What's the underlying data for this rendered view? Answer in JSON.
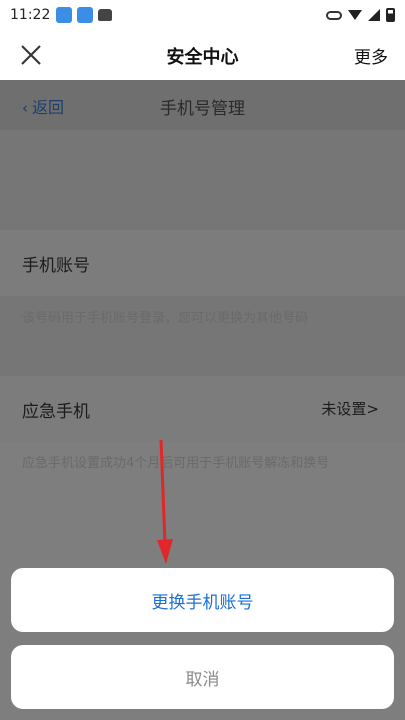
{
  "status_bar": {
    "time": "11:22"
  },
  "title_bar": {
    "title": "安全中心",
    "more_label": "更多"
  },
  "sub_header": {
    "back_label": "返回",
    "back_chevron": "‹",
    "title": "手机号管理"
  },
  "phone_account": {
    "label": "手机账号",
    "description": "该号码用于手机账号登录，您可以更换为其他号码"
  },
  "emergency_phone": {
    "label": "应急手机",
    "value": "未设置>",
    "description": "应急手机设置成功4个月后可用于手机账号解冻和换号"
  },
  "action_sheet": {
    "primary_label": "更换手机账号",
    "cancel_label": "取消"
  },
  "colors": {
    "accent": "#1b6fd6",
    "arrow": "#e0282b",
    "overlay": "#7e7e7e"
  }
}
